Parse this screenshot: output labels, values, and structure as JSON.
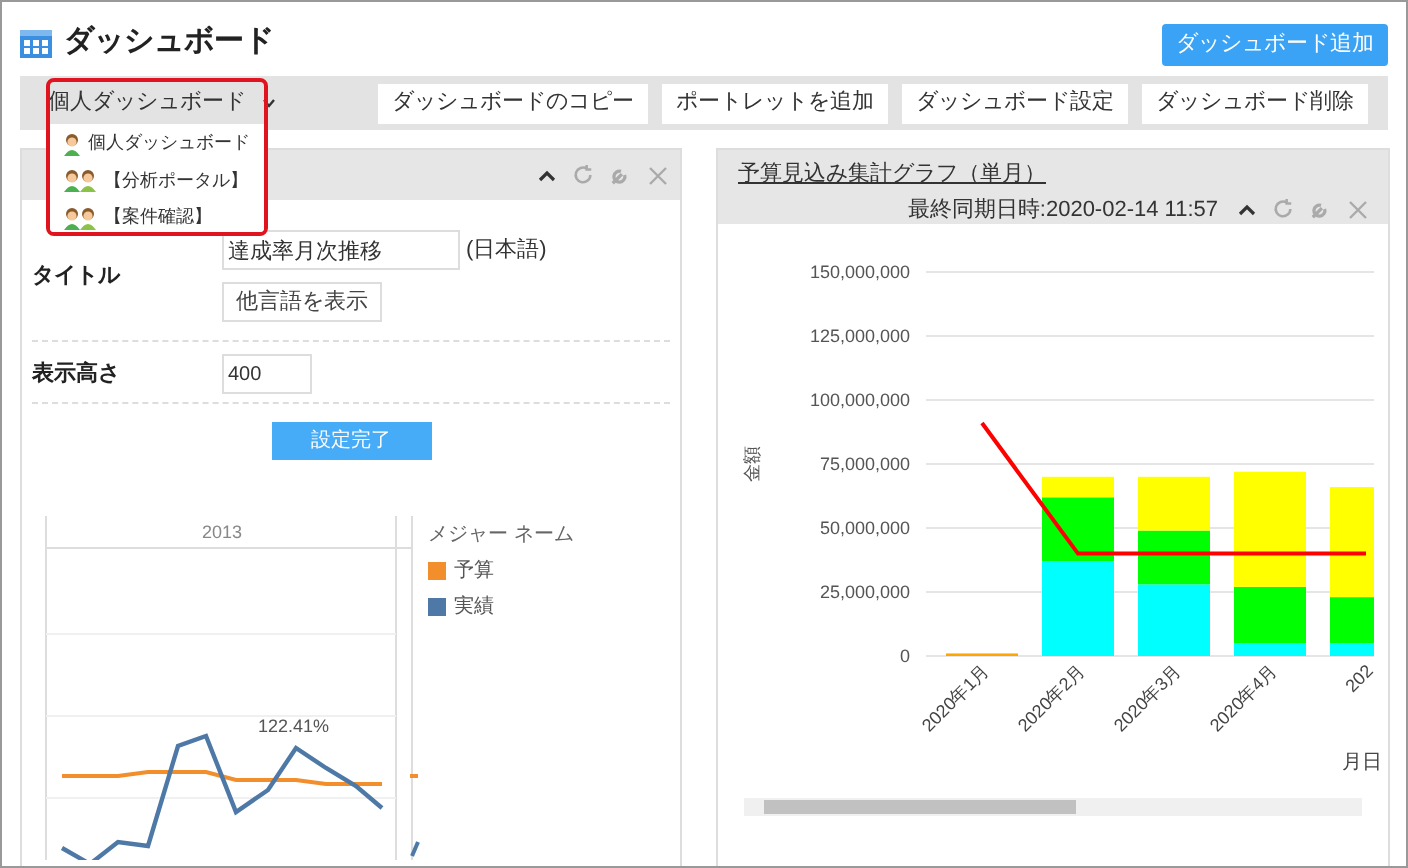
{
  "page": {
    "title": "ダッシュボード",
    "add_button": "ダッシュボード追加"
  },
  "toolbar": {
    "dropdown": {
      "label": "個人ダッシュボード",
      "expanded": true,
      "options": [
        {
          "label": "個人ダッシュボード",
          "kind": "single"
        },
        {
          "label": "【分析ポータル】",
          "kind": "group"
        },
        {
          "label": "【案件確認】",
          "kind": "group"
        }
      ]
    },
    "buttons": [
      "ダッシュボードのコピー",
      "ポートレットを追加",
      "ダッシュボード設定",
      "ダッシュボード削除"
    ]
  },
  "left_portlet": {
    "form": {
      "title_label": "タイトル",
      "title_value": "達成率月次推移",
      "language": "(日本語)",
      "other_lang_button": "他言語を表示",
      "height_label": "表示高さ",
      "height_value": "400",
      "done_button": "設定完了"
    },
    "chart": {
      "column_header": "2013",
      "annotation": "122.41%",
      "legend_title": "メジャー ネーム",
      "legend": [
        {
          "label": "予算",
          "color": "#f28e2b"
        },
        {
          "label": "実績",
          "color": "#4e79a7"
        }
      ]
    }
  },
  "right_portlet": {
    "title": "予算見込み集計グラフ（単月）",
    "sync": "最終同期日時:2020-02-14 11:57",
    "chart_data": {
      "type": "bar",
      "stacked": true,
      "grid": true,
      "ylabel": "金額",
      "xlabel": "月日",
      "categories": [
        "2020年1月",
        "2020年2月",
        "2020年3月",
        "2020年4月",
        "202"
      ],
      "yticks": [
        {
          "value": 0,
          "label": "0"
        },
        {
          "value": 25000000,
          "label": "25,000,000"
        },
        {
          "value": 50000000,
          "label": "50,000,000"
        },
        {
          "value": 75000000,
          "label": "75,000,000"
        },
        {
          "value": 100000000,
          "label": "100,000,000"
        },
        {
          "value": 125000000,
          "label": "125,000,000"
        },
        {
          "value": 150000000,
          "label": "150,000,000"
        }
      ],
      "ylim": [
        0,
        150000000
      ],
      "series": [
        {
          "color": "#ffa500",
          "values": [
            1000000,
            null,
            null,
            null,
            null
          ]
        },
        {
          "color": "#00ffff",
          "values": [
            null,
            37000000,
            28000000,
            5000000,
            5000000
          ]
        },
        {
          "color": "#00ff00",
          "values": [
            null,
            25000000,
            21000000,
            22000000,
            18000000
          ]
        },
        {
          "color": "#ffff00",
          "values": [
            null,
            8000000,
            21000000,
            45000000,
            43000000
          ]
        },
        {
          "color": "#ff0000",
          "type": "line",
          "values": [
            91000000,
            40000000,
            40000000,
            40000000,
            40000000
          ]
        }
      ]
    }
  }
}
